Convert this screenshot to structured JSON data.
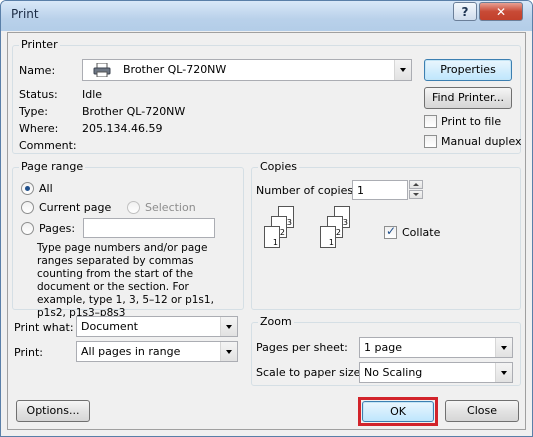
{
  "window": {
    "title": "Print",
    "help_glyph": "?",
    "close_glyph": "✕"
  },
  "printer": {
    "group_label": "Printer",
    "name_label": "Name:",
    "name_value": "Brother QL-720NW",
    "status_label": "Status:",
    "status_value": "Idle",
    "type_label": "Type:",
    "type_value": "Brother QL-720NW",
    "where_label": "Where:",
    "where_value": "205.134.46.59",
    "comment_label": "Comment:",
    "comment_value": "",
    "properties_button": "Properties",
    "find_printer_button": "Find Printer...",
    "print_to_file_label": "Print to file",
    "print_to_file_checked": false,
    "manual_duplex_label": "Manual duplex",
    "manual_duplex_checked": false
  },
  "page_range": {
    "group_label": "Page range",
    "all_label": "All",
    "current_page_label": "Current page",
    "selection_label": "Selection",
    "pages_label": "Pages:",
    "pages_value": "",
    "selected": "All",
    "help_text": "Type page numbers and/or page ranges separated by commas counting from the start of the document or the section. For example, type 1, 3, 5–12 or p1s1, p1s2, p1s3–p8s3"
  },
  "copies": {
    "group_label": "Copies",
    "number_label": "Number of copies:",
    "number_value": "1",
    "collate_label": "Collate",
    "collate_checked": true,
    "page_numbers": [
      "1",
      "2",
      "3"
    ]
  },
  "print_what": {
    "label": "Print what:",
    "value": "Document"
  },
  "print": {
    "label": "Print:",
    "value": "All pages in range"
  },
  "zoom": {
    "group_label": "Zoom",
    "pages_per_sheet_label": "Pages per sheet:",
    "pages_per_sheet_value": "1 page",
    "scale_label": "Scale to paper size:",
    "scale_value": "No Scaling"
  },
  "buttons": {
    "options": "Options...",
    "ok": "OK",
    "close": "Close"
  },
  "icons": {
    "printer": "printer-icon"
  },
  "colors": {
    "highlight": "#d2232a",
    "title_bar": "#b9d1ea"
  }
}
